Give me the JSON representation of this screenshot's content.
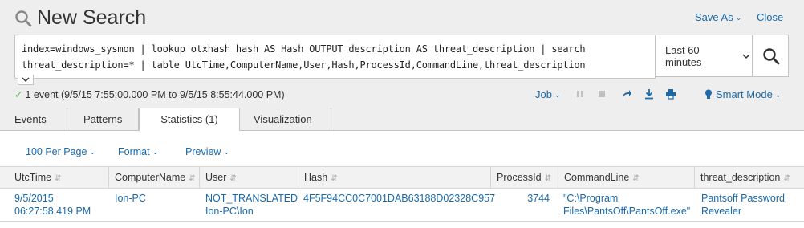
{
  "header": {
    "title": "New Search",
    "save_as": "Save As",
    "close": "Close"
  },
  "search": {
    "query_line1": "index=windows_sysmon | lookup otxhash hash AS Hash OUTPUT description AS threat_description | search",
    "query_line2": "threat_description=* | table UtcTime,ComputerName,User,Hash,ProcessId,CommandLine,threat_description",
    "time_range": "Last 60 minutes"
  },
  "status": {
    "text": "1 event (9/5/15 7:55:00.000 PM to 9/5/15 8:55:44.000 PM)",
    "job_label": "Job",
    "mode_label": "Smart Mode"
  },
  "tabs": [
    {
      "label": "Events"
    },
    {
      "label": "Patterns"
    },
    {
      "label": "Statistics (1)"
    },
    {
      "label": "Visualization"
    }
  ],
  "toolbar": {
    "per_page": "100 Per Page",
    "format": "Format",
    "preview": "Preview"
  },
  "table": {
    "columns": [
      "UtcTime",
      "ComputerName",
      "User",
      "Hash",
      "ProcessId",
      "CommandLine",
      "threat_description"
    ],
    "rows": [
      {
        "UtcTime_1": "9/5/2015",
        "UtcTime_2": "06:27:58.419 PM",
        "ComputerName": "Ion-PC",
        "User_1": "NOT_TRANSLATED",
        "User_2": "Ion-PC\\Ion",
        "Hash": "4F5F94CC0C7001DAB63188D02328C957",
        "ProcessId": "3744",
        "CommandLine_1": "\"C:\\Program",
        "CommandLine_2": "Files\\PantsOff\\PantsOff.exe\"",
        "threat_1": "Pantsoff Password",
        "threat_2": "Revealer"
      }
    ]
  },
  "colors": {
    "link": "#1a6aab",
    "header_bg": "#eeeeee",
    "check": "#5cb85c"
  }
}
